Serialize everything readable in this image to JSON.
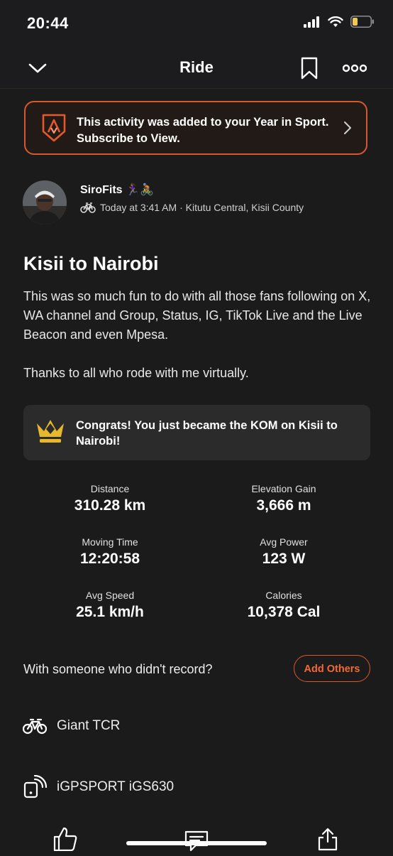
{
  "status_bar": {
    "time": "20:44"
  },
  "nav": {
    "title": "Ride"
  },
  "promo": {
    "text_line1": "This activity was added to your Year in Sport.",
    "text_line2": "Subscribe to View."
  },
  "athlete": {
    "name": "SiroFits",
    "emoji": "🏃🏾‍♀️🚴🏾",
    "meta": "Today at 3:41 AM · Kitutu Central, Kisii County"
  },
  "activity": {
    "title": "Kisii to Nairobi",
    "description_p1": "This was so much fun to do with all those fans following on X, WA channel and Group, Status, IG, TikTok Live and the Live Beacon and even Mpesa.",
    "description_p2": "Thanks to all who rode with me virtually."
  },
  "kom": {
    "text": "Congrats! You just became the KOM on Kisii to Nairobi!"
  },
  "stats": [
    {
      "label": "Distance",
      "value": "310.28 km"
    },
    {
      "label": "Elevation Gain",
      "value": "3,666 m"
    },
    {
      "label": "Moving Time",
      "value": "12:20:58"
    },
    {
      "label": "Avg Power",
      "value": "123 W"
    },
    {
      "label": "Avg Speed",
      "value": "25.1 km/h"
    },
    {
      "label": "Calories",
      "value": "10,378 Cal"
    }
  ],
  "with_others": {
    "prompt": "With someone who didn't record?",
    "button": "Add Others"
  },
  "gear": {
    "bike": "Giant TCR",
    "device": "iGPSPORT iGS630"
  },
  "colors": {
    "accent": "#f26a32",
    "background": "#1b1b1b",
    "card": "#2b2b2b",
    "crown": "#e7b82c"
  }
}
